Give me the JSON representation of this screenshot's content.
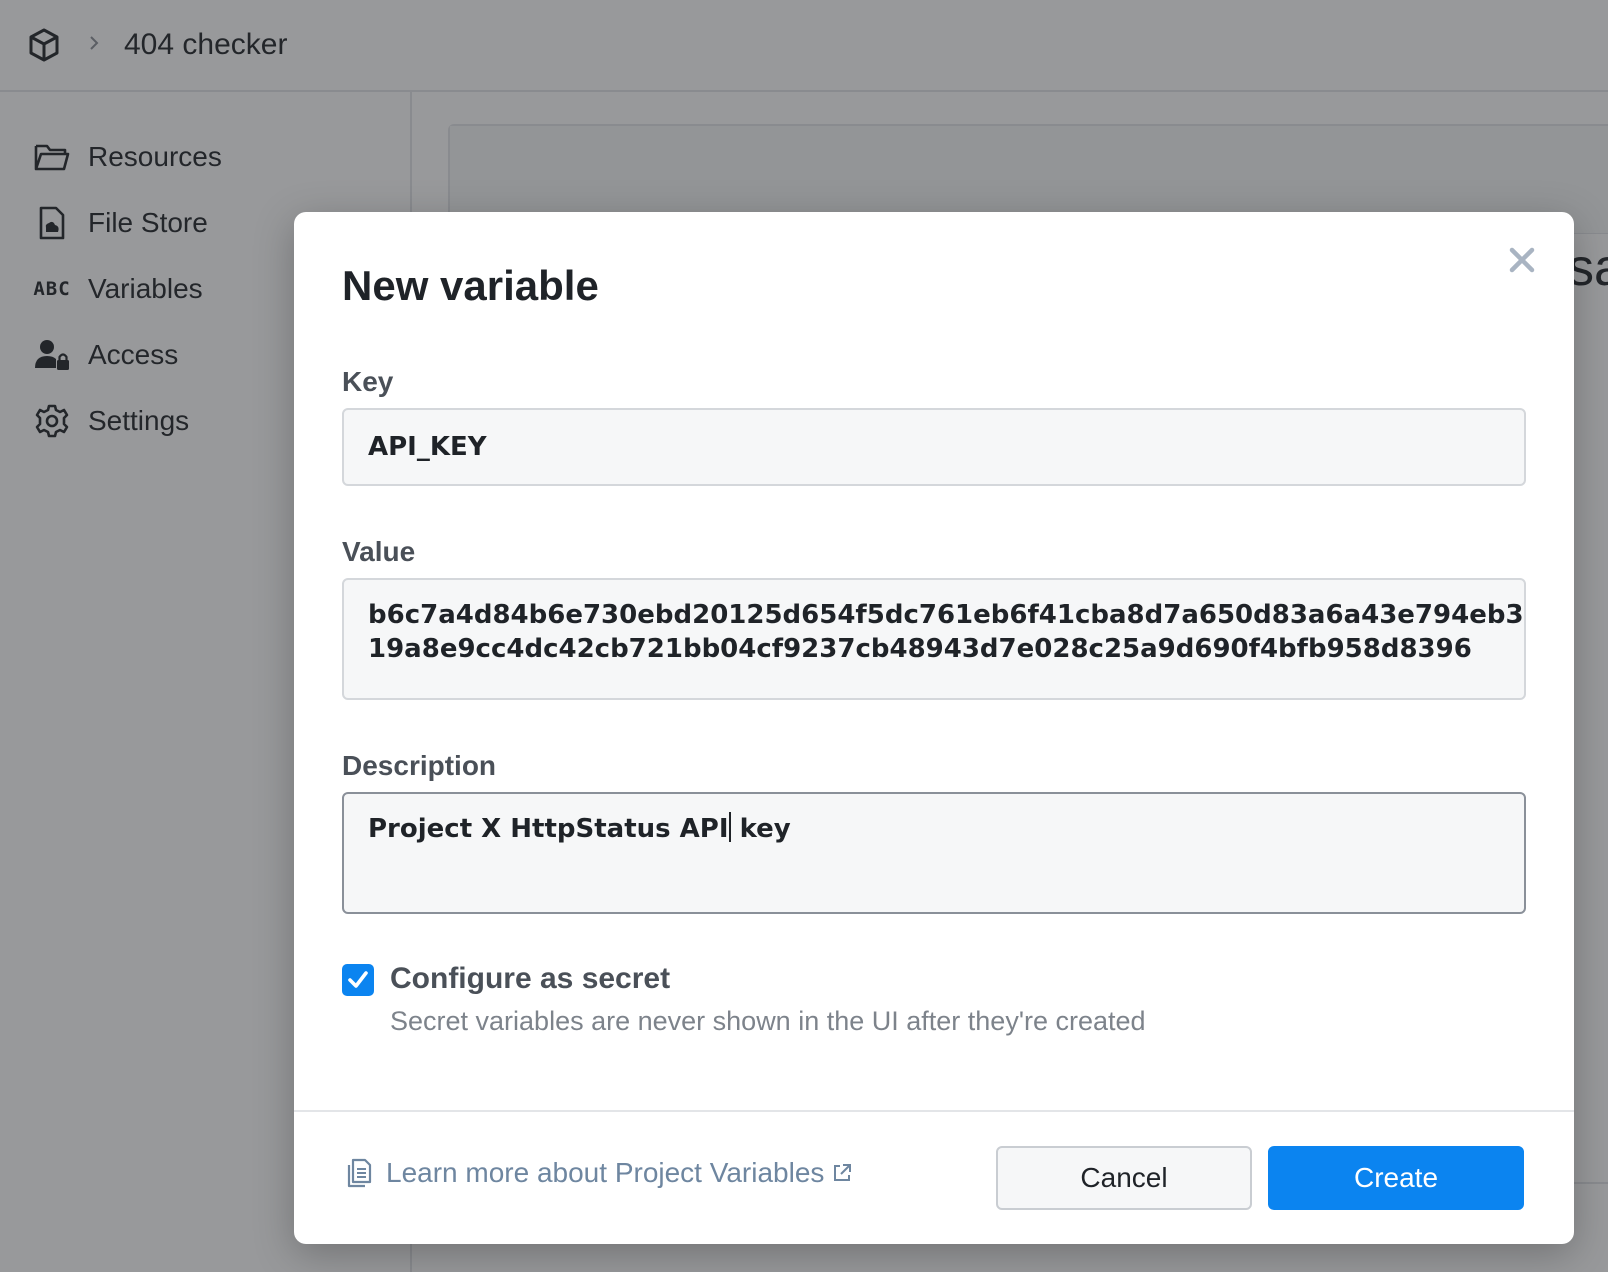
{
  "header": {
    "logo_icon": "cube-icon",
    "separator_icon": "chevron-right-icon",
    "project_name": "404 checker"
  },
  "sidebar": {
    "items": [
      {
        "icon": "folder-icon",
        "label": "Resources"
      },
      {
        "icon": "file-icon",
        "label": "File Store"
      },
      {
        "icon": "abc-icon",
        "icon_text": "ABC",
        "label": "Variables"
      },
      {
        "icon": "user-lock-icon",
        "label": "Access"
      },
      {
        "icon": "gear-icon",
        "label": "Settings"
      }
    ]
  },
  "background": {
    "partial_text": "sa"
  },
  "modal": {
    "title": "New variable",
    "close_icon": "close-icon",
    "key": {
      "label": "Key",
      "value": "API_KEY"
    },
    "value": {
      "label": "Value",
      "line1": "b6c7a4d84b6e730ebd20125d654f5dc761eb6f41cba8d7a650d83a6a43e794eb3",
      "line2": "19a8e9cc4dc42cb721bb04cf9237cb48943d7e028c25a9d690f4bfb958d8396"
    },
    "description": {
      "label": "Description",
      "value_before_cursor": "Project X HttpStatus API",
      "value_after_cursor": " key"
    },
    "secret": {
      "checked": true,
      "label": "Configure as secret",
      "help": "Secret variables are never shown in the UI after they're created"
    },
    "footer": {
      "learn_icon": "document-icon",
      "learn_text": "Learn more about Project Variables",
      "external_icon": "external-link-icon",
      "cancel_label": "Cancel",
      "create_label": "Create"
    }
  },
  "colors": {
    "accent": "#0b84f0",
    "link": "#6e86a0",
    "overlay": "rgba(40,42,46,0.48)"
  }
}
